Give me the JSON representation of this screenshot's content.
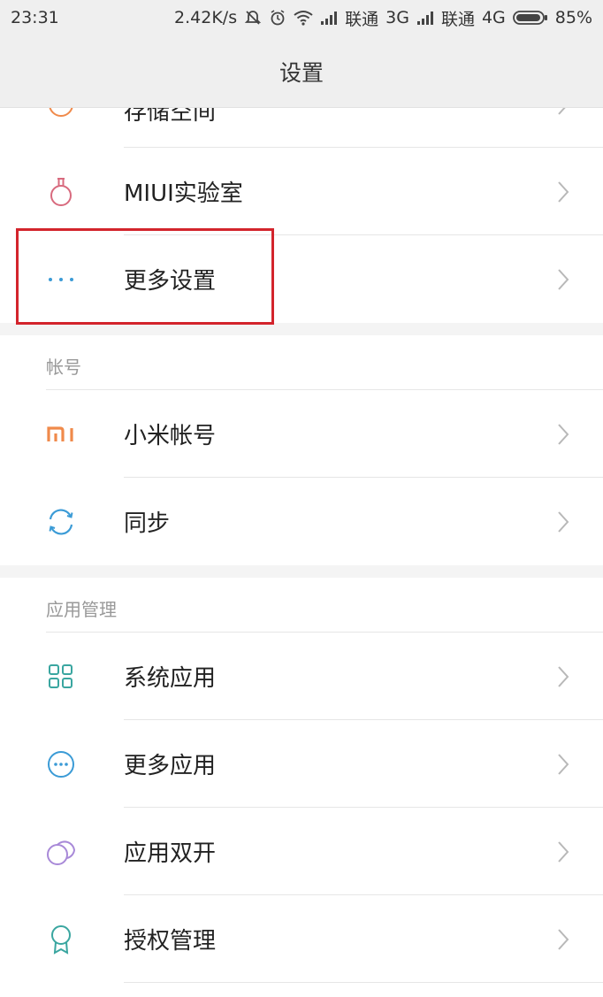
{
  "status_bar": {
    "time": "23:31",
    "speed": "2.42K/s",
    "carrier1": "联通",
    "net1": "3G",
    "carrier2": "联通",
    "net2": "4G",
    "battery": "85%"
  },
  "header": {
    "title": "设置"
  },
  "rows_top": [
    {
      "label": "存储空间",
      "icon": "storage-icon"
    },
    {
      "label": "MIUI实验室",
      "icon": "flask-icon"
    },
    {
      "label": "更多设置",
      "icon": "more-dots-icon"
    }
  ],
  "section_account": {
    "title": "帐号",
    "items": [
      {
        "label": "小米帐号",
        "icon": "mi-logo-icon"
      },
      {
        "label": "同步",
        "icon": "sync-icon"
      }
    ]
  },
  "section_apps": {
    "title": "应用管理",
    "items": [
      {
        "label": "系统应用",
        "icon": "grid-icon"
      },
      {
        "label": "更多应用",
        "icon": "more-apps-icon"
      },
      {
        "label": "应用双开",
        "icon": "dual-apps-icon"
      },
      {
        "label": "授权管理",
        "icon": "permission-icon"
      }
    ]
  },
  "colors": {
    "highlight_border": "#d3242c",
    "orange": "#f08a4b",
    "teal": "#3aa6a0",
    "blue": "#3b9bd6",
    "purple": "#a889d8",
    "pink": "#d86a7e"
  }
}
